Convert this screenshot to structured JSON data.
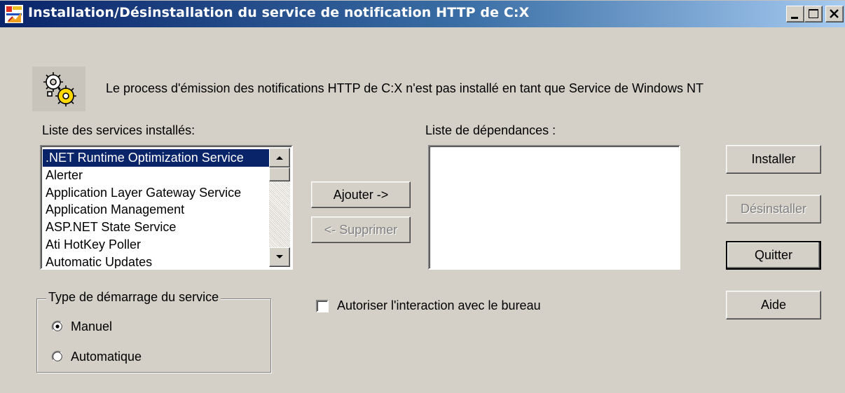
{
  "window": {
    "title": "Installation/Désinstallation du service de notification HTTP de C:X",
    "controls": [
      "minimize",
      "maximize",
      "close"
    ]
  },
  "header": {
    "icon": "gears-icon",
    "message": "Le process d'émission des notifications HTTP de C:X n'est pas installé en tant que Service de Windows NT"
  },
  "services": {
    "label": "Liste des services installés:",
    "items": [
      ".NET Runtime Optimization Service",
      "Alerter",
      "Application Layer Gateway Service",
      "Application Management",
      "ASP.NET State Service",
      "Ati HotKey Poller",
      "Automatic Updates"
    ],
    "selected_index": 0
  },
  "dependencies": {
    "label": "Liste de dépendances :",
    "items": []
  },
  "buttons": {
    "add": "Ajouter ->",
    "remove": "<- Supprimer",
    "install": "Installer",
    "uninstall": "Désinstaller",
    "quit": "Quitter",
    "help": "Aide"
  },
  "startup": {
    "group_label": "Type de démarrage du service",
    "manual_label": "Manuel",
    "automatic_label": "Automatique",
    "selected": "Manuel"
  },
  "interaction": {
    "label": "Autoriser l'interaction avec le bureau",
    "checked": false
  },
  "colors": {
    "face": "#d4d0c8",
    "title_start": "#0a246a",
    "title_end": "#a6caf0",
    "selection": "#0a246a"
  }
}
